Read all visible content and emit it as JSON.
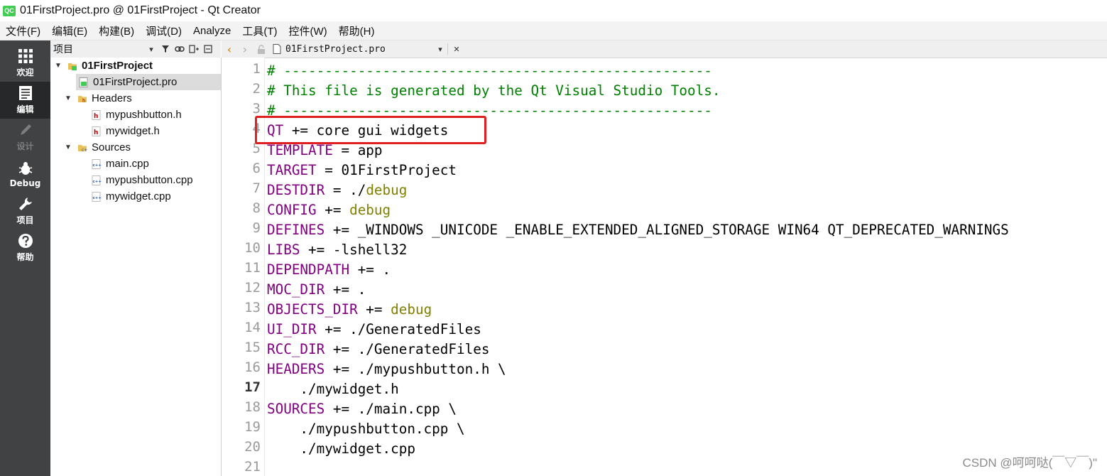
{
  "window": {
    "title": "01FirstProject.pro @ 01FirstProject - Qt Creator",
    "app_icon_label": "QC"
  },
  "menubar": {
    "items": [
      "文件(F)",
      "编辑(E)",
      "构建(B)",
      "调试(D)",
      "Analyze",
      "工具(T)",
      "控件(W)",
      "帮助(H)"
    ]
  },
  "modebar": {
    "modes": [
      {
        "label": "欢迎",
        "icon": "grid-icon",
        "active": false,
        "enabled": true
      },
      {
        "label": "编辑",
        "icon": "document-icon",
        "active": true,
        "enabled": true
      },
      {
        "label": "设计",
        "icon": "pencil-icon",
        "active": false,
        "enabled": false
      },
      {
        "label": "Debug",
        "icon": "bug-icon",
        "active": false,
        "enabled": true
      },
      {
        "label": "项目",
        "icon": "wrench-icon",
        "active": false,
        "enabled": true
      },
      {
        "label": "帮助",
        "icon": "help-icon",
        "active": false,
        "enabled": true
      }
    ]
  },
  "project_panel": {
    "title": "项目",
    "tree": {
      "project": "01FirstProject",
      "pro_file": "01FirstProject.pro",
      "headers_label": "Headers",
      "headers": [
        "mypushbutton.h",
        "mywidget.h"
      ],
      "sources_label": "Sources",
      "sources": [
        "main.cpp",
        "mypushbutton.cpp",
        "mywidget.cpp"
      ]
    }
  },
  "editor": {
    "current_file": "01FirstProject.pro",
    "current_line": 17,
    "line_numbers": [
      "1",
      "2",
      "3",
      "4",
      "5",
      "6",
      "7",
      "8",
      "9",
      "10",
      "11",
      "12",
      "13",
      "14",
      "15",
      "16",
      "17",
      "18",
      "19",
      "20",
      "21"
    ],
    "lines": [
      "# ----------------------------------------------------",
      "# This file is generated by the Qt Visual Studio Tools.",
      "# ----------------------------------------------------",
      "QT += core gui widgets",
      "TEMPLATE = app",
      "TARGET = 01FirstProject",
      "DESTDIR = ./debug",
      "CONFIG += debug",
      "DEFINES += _WINDOWS _UNICODE _ENABLE_EXTENDED_ALIGNED_STORAGE WIN64 QT_DEPRECATED_WARNINGS",
      "LIBS += -lshell32",
      "DEPENDPATH += .",
      "MOC_DIR += .",
      "OBJECTS_DIR += debug",
      "UI_DIR += ./GeneratedFiles",
      "RCC_DIR += ./GeneratedFiles",
      "HEADERS += ./mypushbutton.h \\",
      "    ./mywidget.h",
      "SOURCES += ./main.cpp \\",
      "    ./mypushbutton.cpp \\",
      "    ./mywidget.cpp",
      ""
    ],
    "highlighted_line": 4,
    "colors": {
      "comment": "#008000",
      "keyword": "#800080",
      "debug_value": "#808000",
      "highlight_box": "#e02020"
    }
  },
  "watermark": "CSDN @呵呵哒(￣▽￣)\""
}
